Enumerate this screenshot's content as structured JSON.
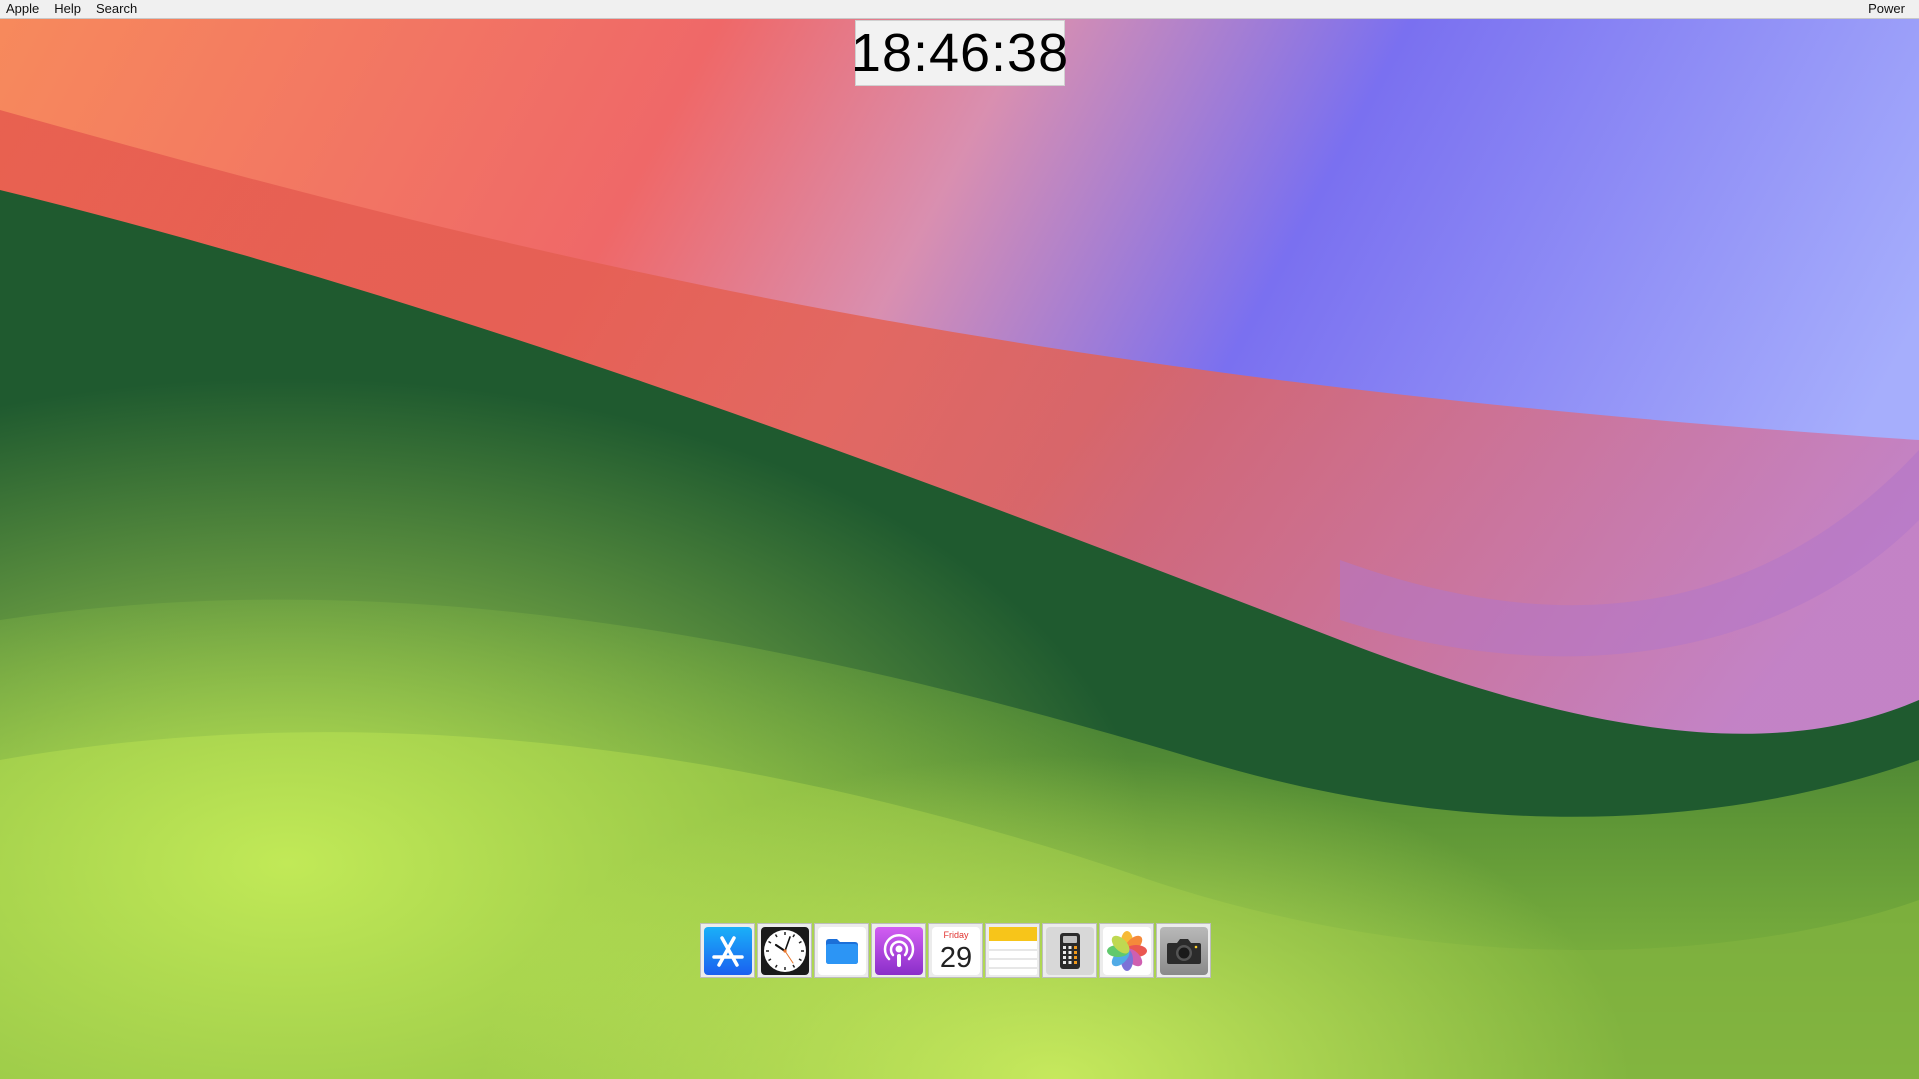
{
  "menubar": {
    "left_items": [
      "Apple",
      "Help",
      "Search"
    ],
    "right_item": "Power"
  },
  "clock": {
    "time": "18:46:38"
  },
  "dock": {
    "items": [
      {
        "icon": "app-store-icon",
        "color": "#1e7cf4"
      },
      {
        "icon": "clock-icon",
        "color": "#1a1a1a"
      },
      {
        "icon": "files-icon",
        "color": "#1b8ef2"
      },
      {
        "icon": "podcasts-icon",
        "color": "#b341dd"
      },
      {
        "icon": "calendar-icon",
        "day": "Friday",
        "date": "29"
      },
      {
        "icon": "notes-icon",
        "color": "#f7c51a"
      },
      {
        "icon": "calculator-icon",
        "color": "#d4d4d4"
      },
      {
        "icon": "photos-icon"
      },
      {
        "icon": "camera-icon",
        "color": "#9a9a9a"
      }
    ]
  },
  "wallpaper": {
    "colors": [
      "#f6875e",
      "#ef6464",
      "#7474f2",
      "#1f5a2f",
      "#8fbf45",
      "#c7ef5e"
    ]
  }
}
